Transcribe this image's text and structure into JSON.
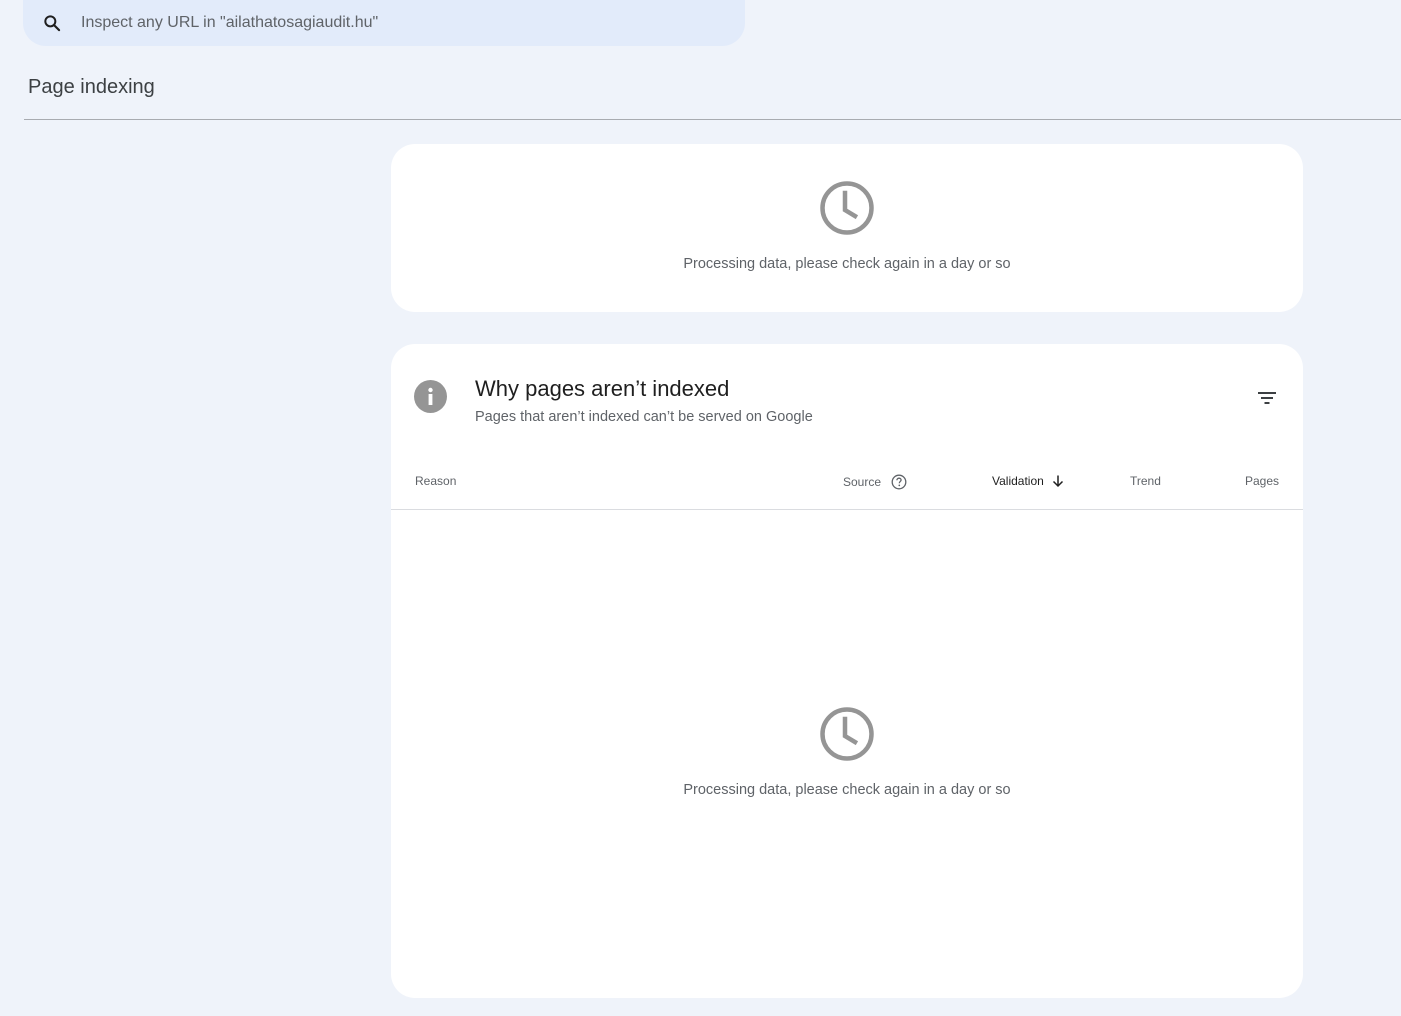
{
  "search": {
    "placeholder": "Inspect any URL in \"ailathatosagiaudit.hu\"",
    "icon": "search-icon"
  },
  "page": {
    "title": "Page indexing"
  },
  "chart_card": {
    "status_icon": "clock-icon",
    "message": "Processing data, please check again in a day or so"
  },
  "issues_card": {
    "icon": "info-icon",
    "title": "Why pages aren’t indexed",
    "subtitle": "Pages that aren’t indexed can’t be served on Google",
    "filter_icon": "filter-icon",
    "columns": {
      "reason": "Reason",
      "source": "Source",
      "validation": "Validation",
      "trend": "Trend",
      "pages": "Pages"
    },
    "sorted_column": "Validation",
    "sort_direction": "descending",
    "status_icon": "clock-icon",
    "message": "Processing data, please check again in a day or so"
  },
  "colors": {
    "background": "#eff3fa",
    "search_bg": "#e2ebfa",
    "card_bg": "#ffffff",
    "icon_gray": "#959595",
    "muted_text": "#5f6368"
  }
}
